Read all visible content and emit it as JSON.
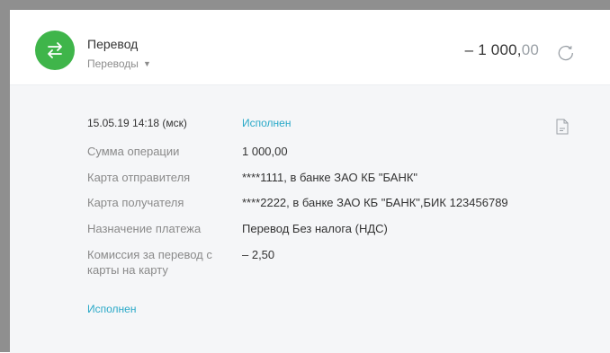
{
  "operation": {
    "title": "Перевод",
    "category": "Переводы",
    "amount_main": "– 1 000,",
    "amount_cents": "00"
  },
  "details": {
    "datetime": "15.05.19 14:18 (мск)",
    "status": "Исполнен",
    "rows": [
      {
        "label": "Сумма операции",
        "value": "1 000,00"
      },
      {
        "label": "Карта отправителя",
        "value": "****1111, в банке ЗАО КБ \"БАНК\""
      },
      {
        "label": "Карта получателя",
        "value": "****2222, в банке ЗАО КБ \"БАНК\",БИК 123456789"
      },
      {
        "label": "Назначение платежа",
        "value": "Перевод Без налога (НДС)"
      },
      {
        "label_line1": "Комиссия за перевод с",
        "label_line2": "карты на карту",
        "value": "– 2,50"
      }
    ],
    "footer_status": "Исполнен"
  },
  "colors": {
    "accent_green": "#3fb54a",
    "status_blue": "#2aa9c8"
  },
  "icons": {
    "avatar": "transfer-arrows-icon",
    "refresh": "refresh-icon",
    "document": "document-icon"
  }
}
